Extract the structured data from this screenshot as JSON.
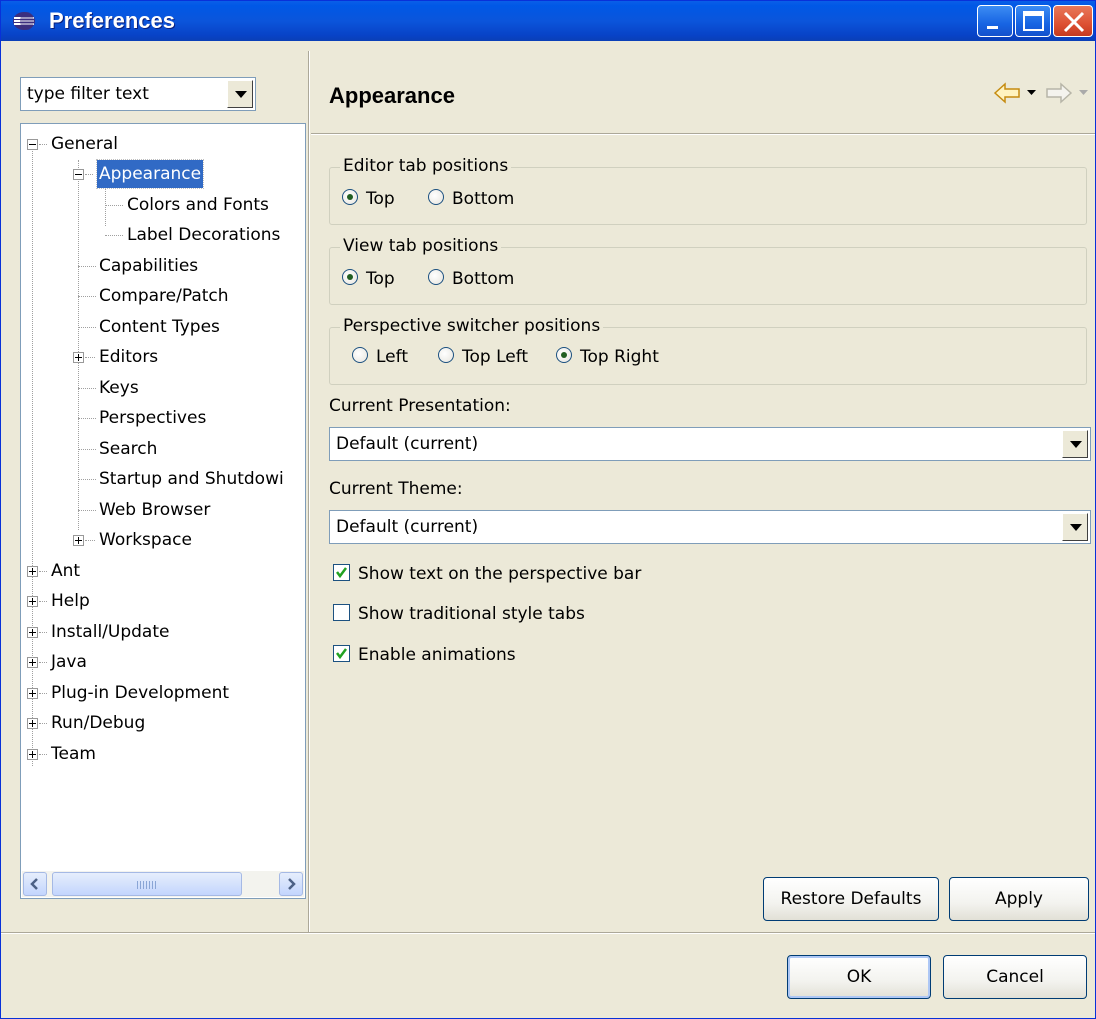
{
  "window": {
    "title": "Preferences",
    "colors": {
      "titlebar": "#0058e6",
      "face": "#ece9d8",
      "selection": "#316ac5",
      "close": "#dd5033"
    }
  },
  "filter": {
    "value": "type filter text"
  },
  "tree": {
    "general": "General",
    "appearance": "Appearance",
    "colors_fonts": "Colors and Fonts",
    "label_decorations": "Label Decorations",
    "capabilities": "Capabilities",
    "compare_patch": "Compare/Patch",
    "content_types": "Content Types",
    "editors": "Editors",
    "keys": "Keys",
    "perspectives": "Perspectives",
    "search": "Search",
    "startup": "Startup and Shutdowi",
    "web_browser": "Web Browser",
    "workspace": "Workspace",
    "ant": "Ant",
    "help": "Help",
    "install_update": "Install/Update",
    "java": "Java",
    "plugin_dev": "Plug-in Development",
    "run_debug": "Run/Debug",
    "team": "Team",
    "scroll_grip": "III"
  },
  "page": {
    "title": "Appearance",
    "nav_icons": [
      "back-arrow-icon",
      "forward-arrow-icon"
    ],
    "editor_tabs": {
      "legend": "Editor tab positions",
      "top": "Top",
      "bottom": "Bottom",
      "selected": "Top"
    },
    "view_tabs": {
      "legend": "View tab positions",
      "top": "Top",
      "bottom": "Bottom",
      "selected": "Top"
    },
    "switcher": {
      "legend": "Perspective switcher positions",
      "left": "Left",
      "top_left": "Top Left",
      "top_right": "Top Right",
      "selected": "Top Right"
    },
    "presentation": {
      "label": "Current Presentation:",
      "value": "Default (current)"
    },
    "theme": {
      "label": "Current Theme:",
      "value": "Default (current)"
    },
    "show_text": {
      "label": "Show text on the perspective bar",
      "checked": true
    },
    "traditional_tabs": {
      "label": "Show traditional style tabs",
      "checked": false
    },
    "animations": {
      "label": "Enable animations",
      "checked": true
    },
    "restore_defaults": "Restore Defaults",
    "apply": "Apply"
  },
  "dialog": {
    "ok": "OK",
    "cancel": "Cancel"
  }
}
